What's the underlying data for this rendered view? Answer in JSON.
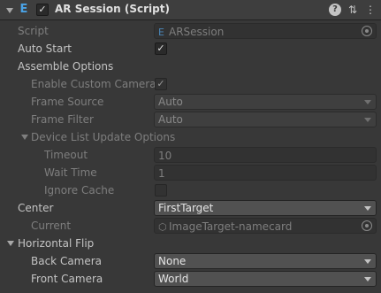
{
  "header": {
    "title": "AR Session (Script)",
    "enabled": true,
    "icons": [
      "fold-arrow-icon",
      "script-icon",
      "help-icon",
      "presets-icon",
      "more-menu-icon"
    ]
  },
  "fields": {
    "script": {
      "label": "Script",
      "value": "ARSession"
    },
    "auto_start": {
      "label": "Auto Start",
      "checked": true
    },
    "assemble_options": {
      "label": "Assemble Options"
    },
    "enable_custom_camera": {
      "label": "Enable Custom Camera",
      "checked": true
    },
    "frame_source": {
      "label": "Frame Source",
      "value": "Auto"
    },
    "frame_filter": {
      "label": "Frame Filter",
      "value": "Auto"
    },
    "device_list": {
      "label": "Device List Update Options"
    },
    "timeout": {
      "label": "Timeout",
      "value": "10"
    },
    "wait_time": {
      "label": "Wait Time",
      "value": "1"
    },
    "ignore_cache": {
      "label": "Ignore Cache",
      "checked": false
    },
    "center": {
      "label": "Center",
      "value": "FirstTarget"
    },
    "current": {
      "label": "Current",
      "value": "ImageTarget-namecard"
    },
    "horizontal_flip": {
      "label": "Horizontal Flip"
    },
    "back_camera": {
      "label": "Back Camera",
      "value": "None"
    },
    "front_camera": {
      "label": "Front Camera",
      "value": "World"
    }
  }
}
